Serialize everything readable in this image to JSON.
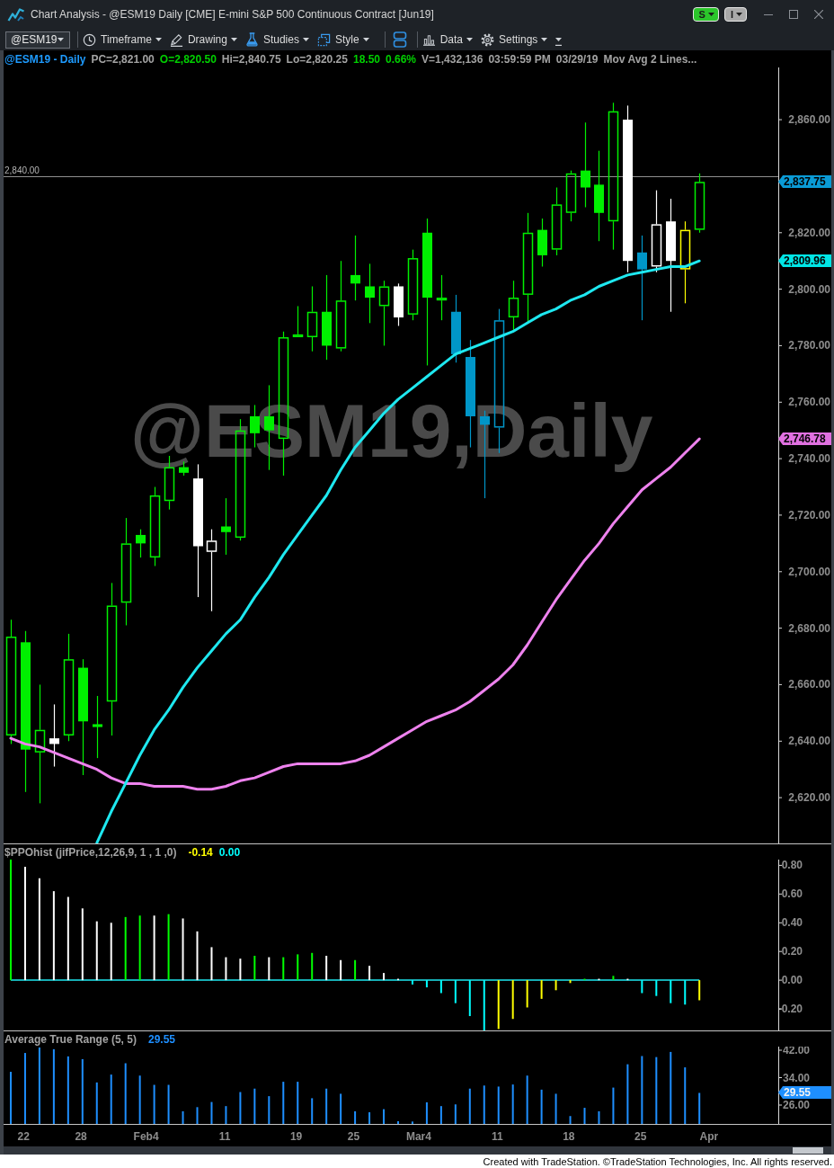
{
  "title_bar": {
    "title": "Chart Analysis - @ESM19 Daily [CME] E-mini S&P 500 Continuous Contract [Jun19]",
    "badges": [
      {
        "label": "S",
        "color": "#2bc52b"
      },
      {
        "label": "I",
        "color": "#a9a9a9"
      }
    ]
  },
  "toolbar": {
    "symbol": "@ESM19",
    "menus": [
      {
        "label": "Timeframe"
      },
      {
        "label": "Drawing"
      },
      {
        "label": "Studies"
      },
      {
        "label": "Style"
      },
      {
        "label": "Data"
      },
      {
        "label": "Settings"
      }
    ]
  },
  "price_panel": {
    "header": [
      {
        "text": "@ESM19 - Daily",
        "color": "#1e9bff"
      },
      {
        "text": "PC=2,821.00",
        "color": "#a3a3a3"
      },
      {
        "text": "O=2,820.50",
        "color": "#00d000"
      },
      {
        "text": "Hi=2,840.75",
        "color": "#a3a3a3"
      },
      {
        "text": "Lo=2,820.25",
        "color": "#a3a3a3"
      },
      {
        "text": "18.50",
        "color": "#00d000"
      },
      {
        "text": "0.66%",
        "color": "#00d000"
      },
      {
        "text": "V=1,432,136",
        "color": "#a3a3a3"
      },
      {
        "text": "03:59:59 PM",
        "color": "#a3a3a3"
      },
      {
        "text": "03/29/19",
        "color": "#a3a3a3"
      },
      {
        "text": "Mov Avg 2 Lines...",
        "color": "#a3a3a3"
      }
    ],
    "watermark": "@ESM19,Daily",
    "tags": [
      {
        "label": "2,837.75",
        "color": "#0a9bd6"
      },
      {
        "label": "2,809.96",
        "color": "#00e6e6"
      },
      {
        "label": "2,746.78",
        "color": "#e070e0"
      }
    ],
    "chart_data": {
      "type": "candlestick",
      "categories": [
        null,
        null,
        null,
        null,
        null,
        null,
        null,
        null,
        null,
        null,
        null,
        null,
        null,
        null,
        null,
        null,
        null,
        null,
        null,
        null,
        null,
        null,
        null,
        null,
        null,
        null,
        null,
        null,
        null,
        null,
        null,
        null,
        null,
        null,
        null,
        null,
        null,
        null,
        null,
        null,
        null,
        null,
        null,
        null,
        null,
        null,
        null,
        null,
        null,
        null,
        null,
        null,
        null,
        null
      ],
      "ohlc": [
        [
          2642,
          2683,
          2639,
          2677
        ],
        [
          2675,
          2679,
          2622,
          2637
        ],
        [
          2636,
          2660,
          2618,
          2644
        ],
        [
          2641,
          2653,
          2631,
          2639
        ],
        [
          2642,
          2678,
          2640,
          2669
        ],
        [
          2666,
          2669,
          2628,
          2647
        ],
        [
          2646,
          2656,
          2634,
          2645
        ],
        [
          2654,
          2696,
          2642,
          2688
        ],
        [
          2689,
          2719,
          2681,
          2710
        ],
        [
          2713,
          2715,
          2705,
          2710
        ],
        [
          2705,
          2730,
          2702,
          2727
        ],
        [
          2725,
          2741,
          2722,
          2737
        ],
        [
          2737,
          2739,
          2734,
          2735
        ],
        [
          2733,
          2738,
          2691,
          2709
        ],
        [
          2707,
          2715,
          2686,
          2711
        ],
        [
          2716,
          2726,
          2706,
          2714
        ],
        [
          2712,
          2754,
          2711,
          2750
        ],
        [
          2755,
          2759,
          2744,
          2749
        ],
        [
          2755,
          2766,
          2736,
          2750
        ],
        [
          2747,
          2785,
          2734,
          2783
        ],
        [
          2783,
          2794,
          2783,
          2784
        ],
        [
          2783,
          2801,
          2778,
          2792
        ],
        [
          2792,
          2805,
          2775,
          2780
        ],
        [
          2779,
          2810,
          2778,
          2796
        ],
        [
          2805,
          2819,
          2796,
          2802
        ],
        [
          2801,
          2809,
          2788,
          2797
        ],
        [
          2794,
          2803,
          2780,
          2801
        ],
        [
          2801,
          2802,
          2787,
          2790
        ],
        [
          2791,
          2814,
          2789,
          2811
        ],
        [
          2820,
          2825,
          2773,
          2797
        ],
        [
          2796,
          2805,
          2789,
          2797
        ],
        [
          2792,
          2798,
          2774,
          2777
        ],
        [
          2776,
          2782,
          2744,
          2755
        ],
        [
          2755,
          2757,
          2726,
          2752
        ],
        [
          2751,
          2793,
          2742,
          2789
        ],
        [
          2790,
          2803,
          2785,
          2797
        ],
        [
          2798,
          2827,
          2788,
          2820
        ],
        [
          2821,
          2825,
          2808,
          2812
        ],
        [
          2814,
          2836,
          2812,
          2830
        ],
        [
          2827,
          2842,
          2824,
          2841
        ],
        [
          2842,
          2859,
          2829,
          2836
        ],
        [
          2837,
          2849,
          2817,
          2827
        ],
        [
          2824,
          2866,
          2814,
          2863
        ],
        [
          2860,
          2865,
          2806,
          2810
        ],
        [
          2813,
          2819,
          2789,
          2807
        ],
        [
          2808,
          2835,
          2806,
          2823
        ],
        [
          2824,
          2832,
          2792,
          2810
        ],
        [
          2807,
          2824,
          2795,
          2821
        ],
        [
          2821,
          2841,
          2820,
          2838
        ],
        null,
        null,
        null,
        null,
        null
      ],
      "colors": [
        "#00f000",
        "#00f000",
        "#00f000",
        "#ffffff",
        "#00f000",
        "#00f000",
        "#00f000",
        "#00f000",
        "#00f000",
        "#00f000",
        "#00f000",
        "#00f000",
        "#00f000",
        "#ffffff",
        "#ffffff",
        "#00f000",
        "#00f000",
        "#00f000",
        "#00f000",
        "#00f000",
        "#00f000",
        "#00f000",
        "#00f000",
        "#00f000",
        "#00f000",
        "#00f000",
        "#00f000",
        "#ffffff",
        "#00f000",
        "#00f000",
        "#00f000",
        "#0096c8",
        "#0096c8",
        "#0096c8",
        "#0096c8",
        "#00f000",
        "#00f000",
        "#00f000",
        "#00f000",
        "#00f000",
        "#00f000",
        "#00f000",
        "#00f000",
        "#ffffff",
        "#0096c8",
        "#ffffff",
        "#ffffff",
        "#ffff00",
        "#00f000",
        null,
        null,
        null,
        null,
        null
      ],
      "series": [
        {
          "type": "line",
          "color": "#1ee8f0",
          "values": [
            null,
            null,
            null,
            null,
            null,
            null,
            2604,
            2615,
            2625,
            2635,
            2644,
            2651,
            2659,
            2666,
            2672,
            2678,
            2683,
            2691,
            2698,
            2706,
            2713,
            2720,
            2727,
            2736,
            2744,
            2750,
            2756,
            2761,
            2765,
            2769,
            2773,
            2777,
            2779,
            2781,
            2783,
            2785,
            2788,
            2791,
            2793,
            2796,
            2798,
            2801,
            2803,
            2805,
            2806,
            2807,
            2808,
            2808,
            2810,
            null,
            null,
            null,
            null,
            null
          ]
        },
        {
          "type": "line",
          "color": "#ee82ee",
          "values": [
            2641,
            2639,
            2638,
            2636,
            2634,
            2632,
            2630,
            2627,
            2625,
            2625,
            2624,
            2624,
            2624,
            2623,
            2623,
            2624,
            2626,
            2627,
            2629,
            2631,
            2632,
            2632,
            2632,
            2632,
            2633,
            2635,
            2638,
            2641,
            2644,
            2647,
            2649,
            2651,
            2654,
            2658,
            2662,
            2667,
            2674,
            2682,
            2690,
            2697,
            2704,
            2710,
            2717,
            2723,
            2729,
            2733,
            2737,
            2742,
            2747,
            null,
            null,
            null,
            null,
            null
          ]
        }
      ],
      "ylim": [
        2603.8,
        2878.5
      ],
      "yticks": [
        {
          "value": 2860,
          "label": "2,860.00"
        },
        {
          "value": 2820,
          "label": "2,820.00"
        },
        {
          "value": 2800,
          "label": "2,800.00"
        },
        {
          "value": 2780,
          "label": "2,780.00"
        },
        {
          "value": 2760,
          "label": "2,760.00"
        },
        {
          "value": 2740,
          "label": "2,740.00"
        },
        {
          "value": 2720,
          "label": "2,720.00"
        },
        {
          "value": 2700,
          "label": "2,700.00"
        },
        {
          "value": 2680,
          "label": "2,680.00"
        },
        {
          "value": 2660,
          "label": "2,660.00"
        },
        {
          "value": 2640,
          "label": "2,640.00"
        },
        {
          "value": 2620,
          "label": "2,620.00"
        }
      ],
      "ref_lines": [
        {
          "axis": "y",
          "value": 2840,
          "label": "2,840.00"
        }
      ]
    }
  },
  "ppo_panel": {
    "title": "$PPOhist (jifPrice,12,26,9, 1 , 1 ,0)",
    "readings": [
      {
        "text": "-0.14",
        "color": "#ffff00"
      },
      {
        "text": "0.00",
        "color": "#00ffff"
      }
    ],
    "chart_data": {
      "type": "bar",
      "stacked": true,
      "categories": [
        null,
        null,
        null,
        null,
        null,
        null,
        null,
        null,
        null,
        null,
        null,
        null,
        null,
        null,
        null,
        null,
        null,
        null,
        null,
        null,
        null,
        null,
        null,
        null,
        null,
        null,
        null,
        null,
        null,
        null,
        null,
        null,
        null,
        null,
        null,
        null,
        null,
        null,
        null,
        null,
        null,
        null,
        null,
        null,
        null,
        null,
        null,
        null,
        null,
        null,
        null,
        null,
        null,
        null
      ],
      "ylim": [
        -0.35,
        0.84
      ],
      "yticks": [
        {
          "value": 0.8,
          "label": "0.80"
        },
        {
          "value": 0.6,
          "label": "0.60"
        },
        {
          "value": 0.4,
          "label": "0.40"
        },
        {
          "value": 0.2,
          "label": "0.20"
        },
        {
          "value": 0,
          "label": "0.00"
        },
        {
          "value": -0.2,
          "label": "-0.20"
        }
      ],
      "ref_lines": [
        {
          "axis": "y",
          "value": 0
        }
      ],
      "series": [
        {
          "color": "#00ff00",
          "values": [
            0.84,
            null,
            null,
            null,
            null,
            null,
            null,
            null,
            0.44,
            0.45,
            null,
            0.46,
            null,
            null,
            null,
            null,
            null,
            0.17,
            null,
            0.16,
            0.18,
            0.19,
            null,
            null,
            0.14,
            null,
            null,
            null,
            null,
            null,
            null,
            null,
            null,
            null,
            null,
            null,
            null,
            null,
            null,
            null,
            0.01,
            null,
            0.03,
            null,
            null,
            null,
            null,
            null,
            null,
            null,
            null,
            null,
            null,
            null
          ]
        },
        {
          "color": "#ffffff",
          "values": [
            null,
            0.79,
            0.71,
            0.62,
            0.58,
            0.5,
            0.41,
            0.4,
            null,
            null,
            0.45,
            null,
            0.43,
            0.34,
            0.23,
            0.16,
            0.15,
            null,
            0.16,
            null,
            null,
            null,
            0.17,
            0.14,
            null,
            0.1,
            0.05,
            0.01,
            null,
            null,
            null,
            null,
            null,
            null,
            null,
            null,
            null,
            null,
            null,
            null,
            null,
            0.01,
            null,
            0.01,
            null,
            null,
            null,
            null,
            null,
            null,
            null,
            null,
            null,
            null
          ]
        },
        {
          "color": "#00ffff",
          "values": [
            null,
            null,
            null,
            null,
            null,
            null,
            null,
            null,
            null,
            null,
            null,
            null,
            null,
            null,
            null,
            null,
            null,
            null,
            null,
            null,
            null,
            null,
            null,
            null,
            null,
            null,
            null,
            null,
            -0.03,
            -0.05,
            -0.09,
            -0.16,
            -0.25,
            -0.35,
            null,
            null,
            null,
            null,
            null,
            null,
            null,
            null,
            null,
            null,
            -0.09,
            -0.11,
            -0.16,
            -0.17,
            null,
            null,
            null,
            null,
            null,
            null
          ]
        },
        {
          "color": "#ffff00",
          "values": [
            null,
            null,
            null,
            null,
            null,
            null,
            null,
            null,
            null,
            null,
            null,
            null,
            null,
            null,
            null,
            null,
            null,
            null,
            null,
            null,
            null,
            null,
            null,
            null,
            null,
            null,
            null,
            null,
            null,
            null,
            null,
            null,
            null,
            null,
            -0.34,
            -0.27,
            -0.19,
            -0.13,
            -0.07,
            -0.02,
            null,
            null,
            null,
            null,
            null,
            null,
            null,
            null,
            -0.14,
            null,
            null,
            null,
            null,
            null
          ]
        }
      ]
    }
  },
  "atr_panel": {
    "title": "Average True Range (5, 5)",
    "readings": [
      {
        "text": "29.55",
        "color": "#1e8fff"
      }
    ],
    "value_tag": "29.55",
    "chart_data": {
      "type": "bar",
      "categories": [
        null,
        "22",
        null,
        null,
        null,
        "28",
        null,
        null,
        null,
        null,
        "Feb4",
        null,
        null,
        null,
        null,
        "11",
        null,
        null,
        null,
        null,
        "19",
        null,
        null,
        null,
        "25",
        null,
        null,
        null,
        null,
        "Mar4",
        null,
        null,
        null,
        null,
        "11",
        null,
        null,
        null,
        null,
        "18",
        null,
        null,
        null,
        null,
        "25",
        null,
        null,
        null,
        null,
        "Apr",
        null,
        null,
        null,
        null
      ],
      "ylim": [
        20.5,
        43.05
      ],
      "yticks": [
        {
          "value": 42,
          "label": "42.00"
        },
        {
          "value": 34,
          "label": "34.00"
        },
        {
          "value": 26,
          "label": "26.00"
        }
      ],
      "series": [
        {
          "color": "#1e8fff",
          "values": [
            35.7,
            41.2,
            42.8,
            42.3,
            40.2,
            39.4,
            32.6,
            34.9,
            38.2,
            34.6,
            31.9,
            31.9,
            24.2,
            25.4,
            26.9,
            25.7,
            29.8,
            30.8,
            28.6,
            32.8,
            32.8,
            28,
            30.8,
            29.3,
            24.2,
            23.9,
            24.8,
            21.3,
            21.2,
            26.8,
            25.7,
            26.2,
            30.8,
            31.7,
            31.4,
            32,
            34.6,
            30.5,
            29.3,
            22.8,
            25.2,
            24.2,
            31.1,
            37.9,
            40.3,
            40,
            41.5,
            37,
            29.55,
            null,
            null,
            null,
            null,
            null
          ]
        }
      ]
    }
  },
  "footer": "Created with TradeStation. ©TradeStation Technologies, Inc. All rights reserved."
}
